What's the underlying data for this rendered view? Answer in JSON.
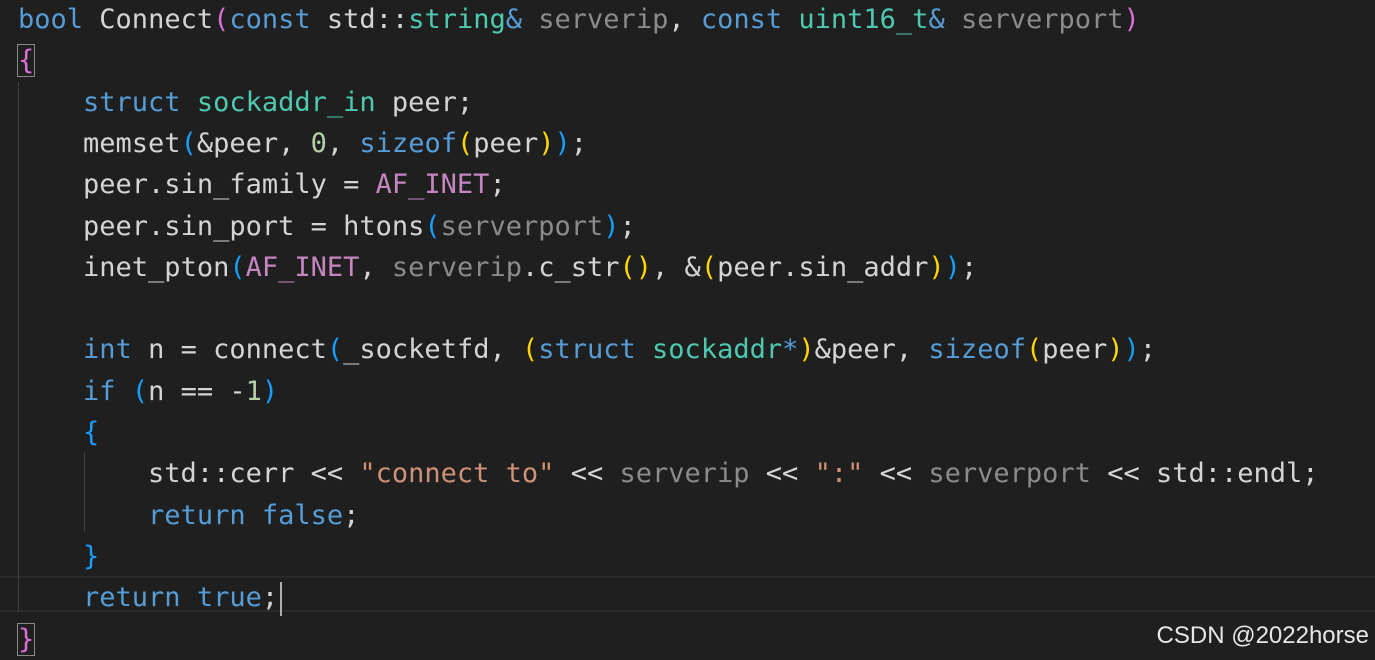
{
  "colors": {
    "background": "#1f1f1f",
    "text": "#d4d4d4",
    "keyword": "#569cd6",
    "type": "#4ec9b0",
    "function": "#dcdcaa",
    "parameter": "#9cdcfe",
    "unused_param": "#8b8b8b",
    "macro": "#c586c0",
    "number": "#b5cea8",
    "string": "#ce9178",
    "bracket1": "#ffd700",
    "bracket2": "#da70d6",
    "bracket3": "#179fff"
  },
  "code": {
    "lines": [
      [
        {
          "t": "bool",
          "c": "#569cd6"
        },
        {
          "t": " ",
          "c": "#d4d4d4"
        },
        {
          "t": "Connect",
          "c": "#d4d4d4"
        },
        {
          "t": "(",
          "c": "#da70d6"
        },
        {
          "t": "const",
          "c": "#569cd6"
        },
        {
          "t": " ",
          "c": "#d4d4d4"
        },
        {
          "t": "std",
          "c": "#d4d4d4"
        },
        {
          "t": "::",
          "c": "#d4d4d4"
        },
        {
          "t": "string",
          "c": "#4ec9b0"
        },
        {
          "t": "&",
          "c": "#569cd6"
        },
        {
          "t": " ",
          "c": "#d4d4d4"
        },
        {
          "t": "serverip",
          "c": "#8b8b8b"
        },
        {
          "t": ", ",
          "c": "#d4d4d4"
        },
        {
          "t": "const",
          "c": "#569cd6"
        },
        {
          "t": " ",
          "c": "#d4d4d4"
        },
        {
          "t": "uint16_t",
          "c": "#4ec9b0"
        },
        {
          "t": "&",
          "c": "#569cd6"
        },
        {
          "t": " ",
          "c": "#d4d4d4"
        },
        {
          "t": "serverport",
          "c": "#8b8b8b"
        },
        {
          "t": ")",
          "c": "#da70d6"
        }
      ],
      [
        {
          "t": "{",
          "c": "#da70d6",
          "box": true
        }
      ],
      [
        {
          "t": "    ",
          "c": "#d4d4d4"
        },
        {
          "t": "struct",
          "c": "#569cd6"
        },
        {
          "t": " ",
          "c": "#d4d4d4"
        },
        {
          "t": "sockaddr_in",
          "c": "#4ec9b0"
        },
        {
          "t": " peer;",
          "c": "#d4d4d4"
        }
      ],
      [
        {
          "t": "    ",
          "c": "#d4d4d4"
        },
        {
          "t": "memset",
          "c": "#d4d4d4"
        },
        {
          "t": "(",
          "c": "#179fff"
        },
        {
          "t": "&peer, ",
          "c": "#d4d4d4"
        },
        {
          "t": "0",
          "c": "#b5cea8"
        },
        {
          "t": ", ",
          "c": "#d4d4d4"
        },
        {
          "t": "sizeof",
          "c": "#569cd6"
        },
        {
          "t": "(",
          "c": "#ffd700"
        },
        {
          "t": "peer",
          "c": "#d4d4d4"
        },
        {
          "t": ")",
          "c": "#ffd700"
        },
        {
          "t": ")",
          "c": "#179fff"
        },
        {
          "t": ";",
          "c": "#d4d4d4"
        }
      ],
      [
        {
          "t": "    ",
          "c": "#d4d4d4"
        },
        {
          "t": "peer.sin_family = ",
          "c": "#d4d4d4"
        },
        {
          "t": "AF_INET",
          "c": "#c586c0"
        },
        {
          "t": ";",
          "c": "#d4d4d4"
        }
      ],
      [
        {
          "t": "    ",
          "c": "#d4d4d4"
        },
        {
          "t": "peer.sin_port = htons",
          "c": "#d4d4d4"
        },
        {
          "t": "(",
          "c": "#179fff"
        },
        {
          "t": "serverport",
          "c": "#8b8b8b"
        },
        {
          "t": ")",
          "c": "#179fff"
        },
        {
          "t": ";",
          "c": "#d4d4d4"
        }
      ],
      [
        {
          "t": "    ",
          "c": "#d4d4d4"
        },
        {
          "t": "inet_pton",
          "c": "#d4d4d4"
        },
        {
          "t": "(",
          "c": "#179fff"
        },
        {
          "t": "AF_INET",
          "c": "#c586c0"
        },
        {
          "t": ", ",
          "c": "#d4d4d4"
        },
        {
          "t": "serverip",
          "c": "#8b8b8b"
        },
        {
          "t": ".c_str",
          "c": "#d4d4d4"
        },
        {
          "t": "()",
          "c": "#ffd700"
        },
        {
          "t": ", &",
          "c": "#d4d4d4"
        },
        {
          "t": "(",
          "c": "#ffd700"
        },
        {
          "t": "peer.sin_addr",
          "c": "#d4d4d4"
        },
        {
          "t": ")",
          "c": "#ffd700"
        },
        {
          "t": ")",
          "c": "#179fff"
        },
        {
          "t": ";",
          "c": "#d4d4d4"
        }
      ],
      [],
      [
        {
          "t": "    ",
          "c": "#d4d4d4"
        },
        {
          "t": "int",
          "c": "#569cd6"
        },
        {
          "t": " n = connect",
          "c": "#d4d4d4"
        },
        {
          "t": "(",
          "c": "#179fff"
        },
        {
          "t": "_socketfd, ",
          "c": "#d4d4d4"
        },
        {
          "t": "(",
          "c": "#ffd700"
        },
        {
          "t": "struct",
          "c": "#569cd6"
        },
        {
          "t": " ",
          "c": "#d4d4d4"
        },
        {
          "t": "sockaddr",
          "c": "#4ec9b0"
        },
        {
          "t": "*",
          "c": "#569cd6"
        },
        {
          "t": ")",
          "c": "#ffd700"
        },
        {
          "t": "&peer, ",
          "c": "#d4d4d4"
        },
        {
          "t": "sizeof",
          "c": "#569cd6"
        },
        {
          "t": "(",
          "c": "#ffd700"
        },
        {
          "t": "peer",
          "c": "#d4d4d4"
        },
        {
          "t": ")",
          "c": "#ffd700"
        },
        {
          "t": ")",
          "c": "#179fff"
        },
        {
          "t": ";",
          "c": "#d4d4d4"
        }
      ],
      [
        {
          "t": "    ",
          "c": "#d4d4d4"
        },
        {
          "t": "if",
          "c": "#569cd6"
        },
        {
          "t": " ",
          "c": "#d4d4d4"
        },
        {
          "t": "(",
          "c": "#179fff"
        },
        {
          "t": "n == -",
          "c": "#d4d4d4"
        },
        {
          "t": "1",
          "c": "#b5cea8"
        },
        {
          "t": ")",
          "c": "#179fff"
        }
      ],
      [
        {
          "t": "    ",
          "c": "#d4d4d4"
        },
        {
          "t": "{",
          "c": "#179fff"
        }
      ],
      [
        {
          "t": "        ",
          "c": "#d4d4d4"
        },
        {
          "t": "std::cerr << ",
          "c": "#d4d4d4"
        },
        {
          "t": "\"connect to\"",
          "c": "#ce9178"
        },
        {
          "t": " << ",
          "c": "#d4d4d4"
        },
        {
          "t": "serverip",
          "c": "#8b8b8b"
        },
        {
          "t": " << ",
          "c": "#d4d4d4"
        },
        {
          "t": "\":\"",
          "c": "#ce9178"
        },
        {
          "t": " << ",
          "c": "#d4d4d4"
        },
        {
          "t": "serverport",
          "c": "#8b8b8b"
        },
        {
          "t": " << std::endl;",
          "c": "#d4d4d4"
        }
      ],
      [
        {
          "t": "        ",
          "c": "#d4d4d4"
        },
        {
          "t": "return",
          "c": "#569cd6"
        },
        {
          "t": " ",
          "c": "#d4d4d4"
        },
        {
          "t": "false",
          "c": "#569cd6"
        },
        {
          "t": ";",
          "c": "#d4d4d4"
        }
      ],
      [
        {
          "t": "    ",
          "c": "#d4d4d4"
        },
        {
          "t": "}",
          "c": "#179fff"
        }
      ],
      [
        {
          "t": "    ",
          "c": "#d4d4d4"
        },
        {
          "t": "return",
          "c": "#569cd6"
        },
        {
          "t": " ",
          "c": "#d4d4d4"
        },
        {
          "t": "true",
          "c": "#569cd6"
        },
        {
          "t": ";",
          "c": "#d4d4d4"
        },
        {
          "cursor": true
        }
      ],
      [
        {
          "t": "}",
          "c": "#da70d6",
          "box": true
        }
      ]
    ]
  },
  "watermark": "CSDN @2022horse"
}
